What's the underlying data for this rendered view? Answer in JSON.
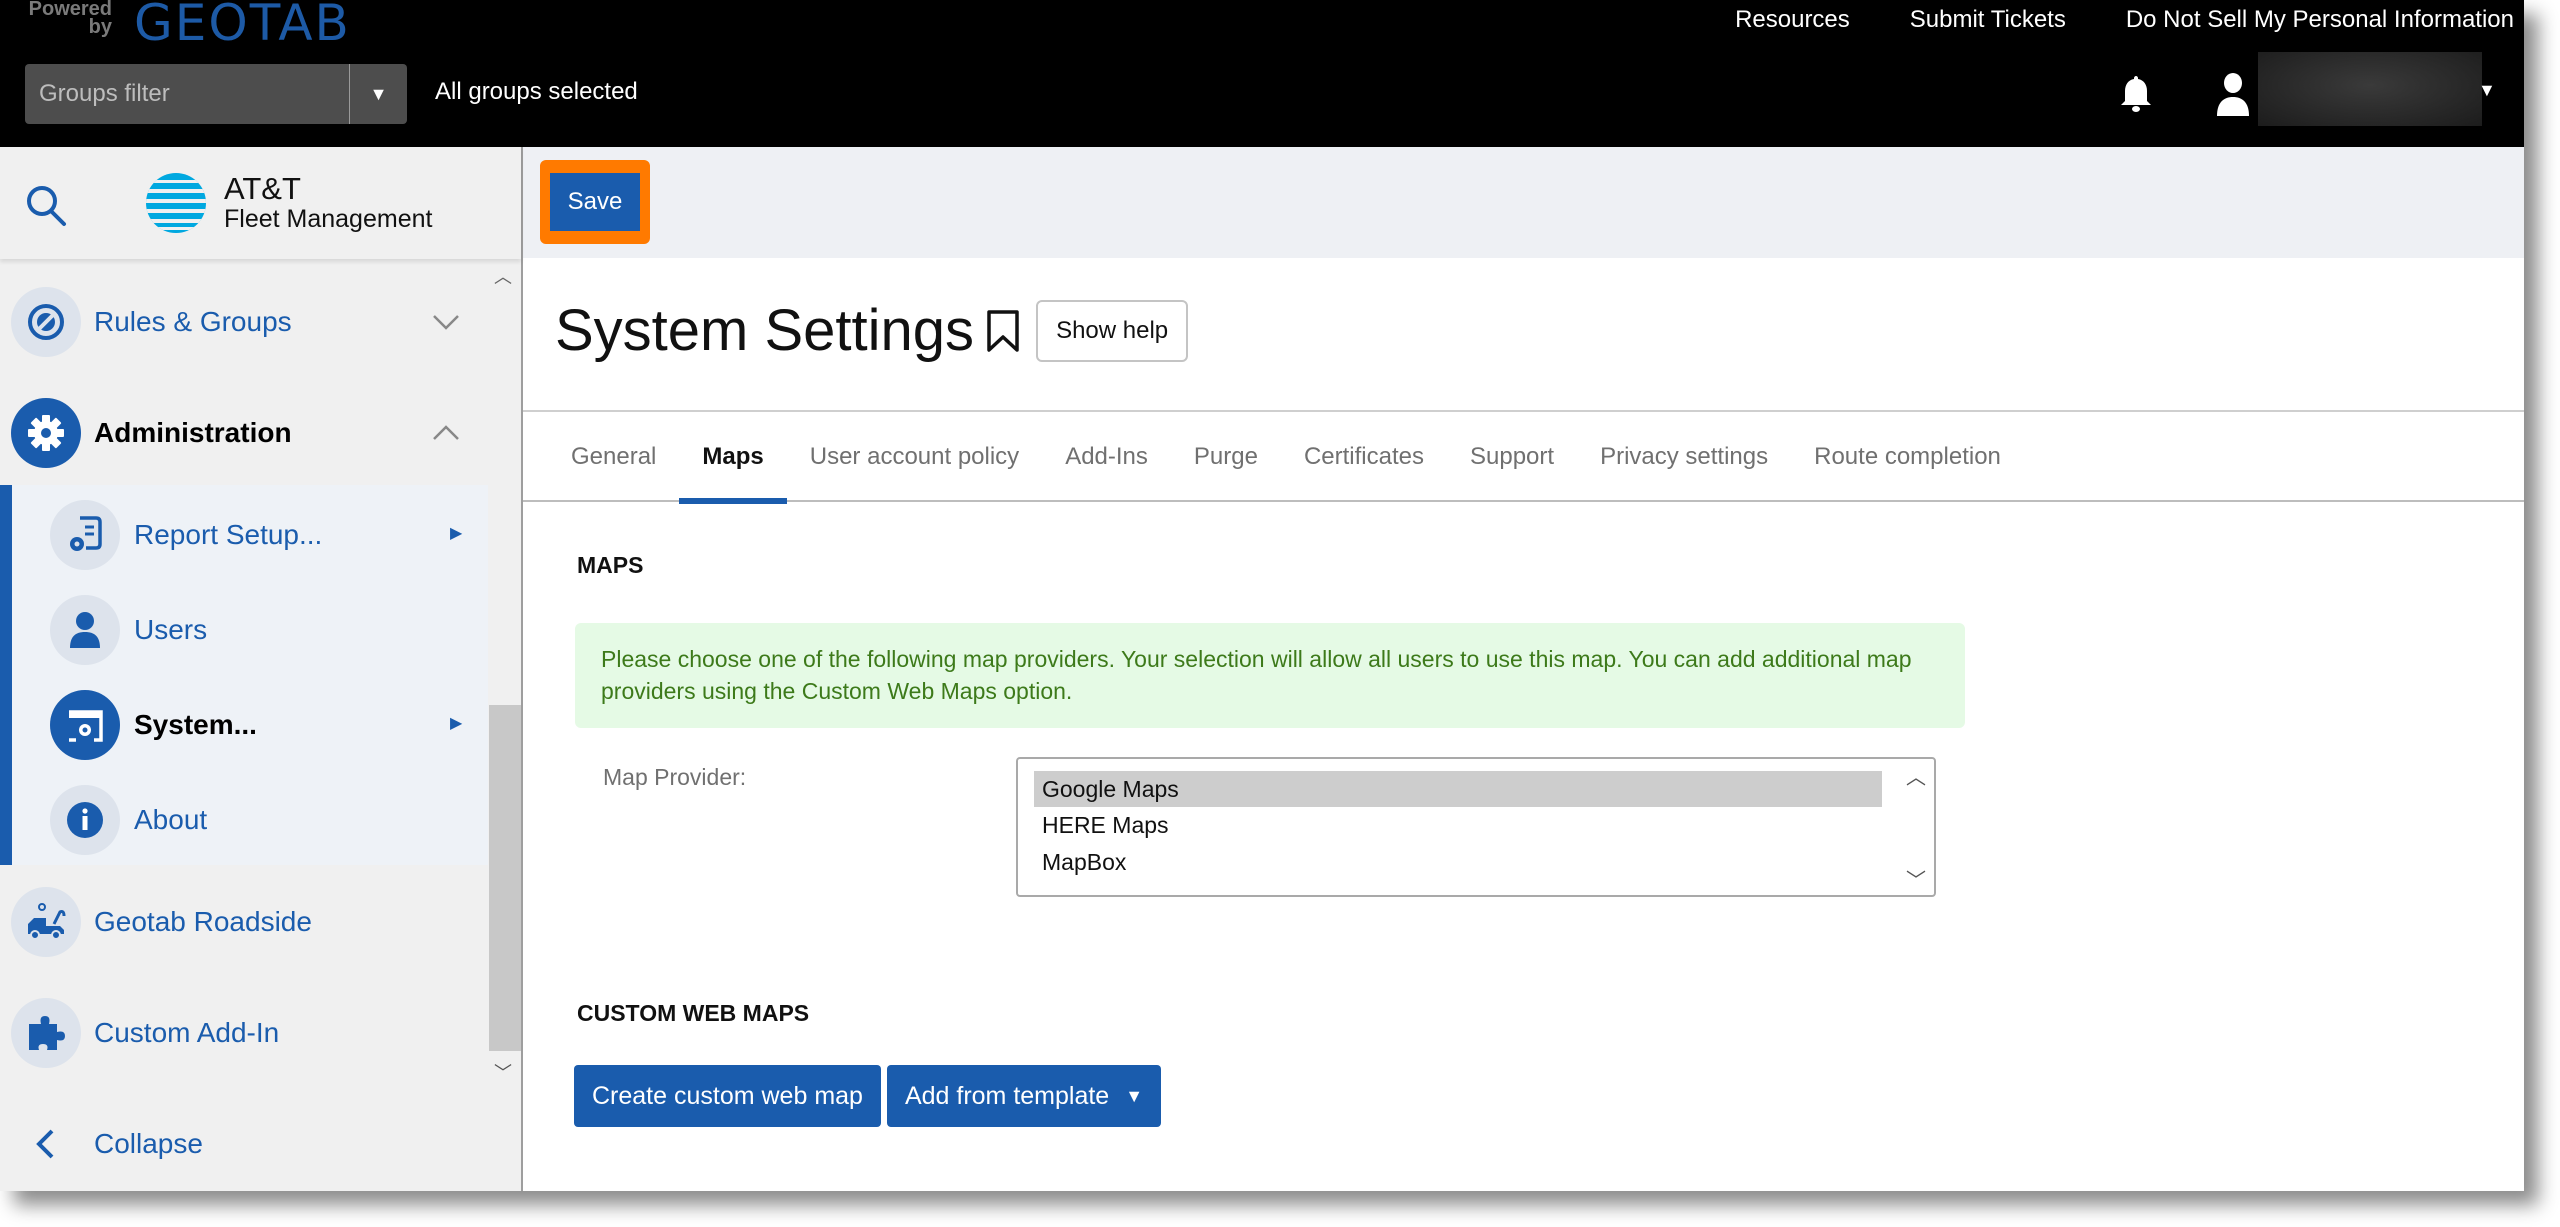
{
  "header": {
    "powered_by": "Powered by",
    "brand": "GEOTAB",
    "links": [
      "Resources",
      "Submit Tickets",
      "Do Not Sell My Personal Information"
    ],
    "groups_filter_placeholder": "Groups filter",
    "groups_status": "All groups selected"
  },
  "sidebar": {
    "brand_title": "AT&T",
    "brand_subtitle": "Fleet Management",
    "items": [
      {
        "label": "Rules & Groups",
        "icon": "rules-icon"
      },
      {
        "label": "Administration",
        "icon": "gear-icon",
        "expanded": true
      },
      {
        "label": "Report Setup...",
        "icon": "report-setup-icon",
        "sub": true
      },
      {
        "label": "Users",
        "icon": "user-icon",
        "sub": true
      },
      {
        "label": "System...",
        "icon": "system-settings-icon",
        "sub": true,
        "active": true
      },
      {
        "label": "About",
        "icon": "info-icon",
        "sub": true
      },
      {
        "label": "Geotab Roadside",
        "icon": "tow-truck-icon"
      },
      {
        "label": "Custom Add-In",
        "icon": "puzzle-icon"
      }
    ],
    "collapse_label": "Collapse"
  },
  "toolbar": {
    "save_label": "Save",
    "highlight_color": "#ff7a00"
  },
  "page": {
    "title": "System Settings",
    "show_help_label": "Show help",
    "tabs": [
      {
        "label": "General"
      },
      {
        "label": "Maps",
        "active": true
      },
      {
        "label": "User account policy"
      },
      {
        "label": "Add-Ins"
      },
      {
        "label": "Purge"
      },
      {
        "label": "Certificates"
      },
      {
        "label": "Support"
      },
      {
        "label": "Privacy settings"
      },
      {
        "label": "Route completion"
      }
    ]
  },
  "maps": {
    "heading": "MAPS",
    "notice": "Please choose one of the following map providers. Your selection will allow all users to use this map. You can add additional map providers using the Custom Web Maps option.",
    "provider_label": "Map Provider:",
    "providers": [
      "Google Maps",
      "HERE Maps",
      "MapBox"
    ],
    "selected_provider": "Google Maps"
  },
  "custom_web_maps": {
    "heading": "CUSTOM WEB MAPS",
    "create_label": "Create custom web map",
    "template_label": "Add from template"
  },
  "colors": {
    "accent": "#1a5cad",
    "header_bg": "#000000",
    "notice_bg": "#e5fae5",
    "notice_text": "#3d7a1a"
  }
}
